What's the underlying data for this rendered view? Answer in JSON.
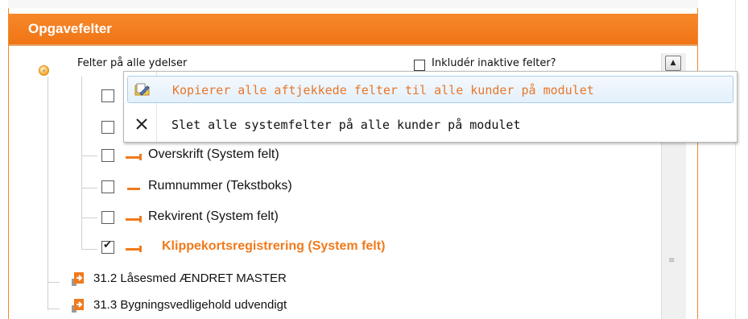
{
  "panel": {
    "title": "Opgavefelter",
    "accent": "#f07516"
  },
  "tree": {
    "root_label": "Felter på alle ydelser",
    "include_inactive_label": "Inkludér inaktive felter?",
    "fields": [
      {
        "label": "Overskrift (System felt)",
        "checked": false,
        "active": false
      },
      {
        "label": "Rumnummer (Tekstboks)",
        "checked": false,
        "active": false
      },
      {
        "label": "Rekvirent (System felt)",
        "checked": false,
        "active": false
      },
      {
        "label": "Klippekortsregistrering (System felt)",
        "checked": true,
        "active": true
      }
    ],
    "modules": [
      {
        "label": "31.2 Låsesmed ÆNDRET MASTER"
      },
      {
        "label": "31.3 Bygningsvedligehold udvendigt"
      }
    ]
  },
  "context_menu": {
    "copy_label": "Kopierer alle aftjekkede felter til alle kunder på modulet",
    "delete_label": "Slet alle systemfelter på alle kunder på modulet",
    "copy_color": "#e8772a"
  },
  "icons": {
    "expander": "collapse-circle-icon",
    "copy": "edit-folder-icon",
    "delete": "close-x-icon",
    "scroll_up": "chevron-up-icon",
    "field": "field-arrow-icon",
    "module": "module-arrow-icon"
  }
}
